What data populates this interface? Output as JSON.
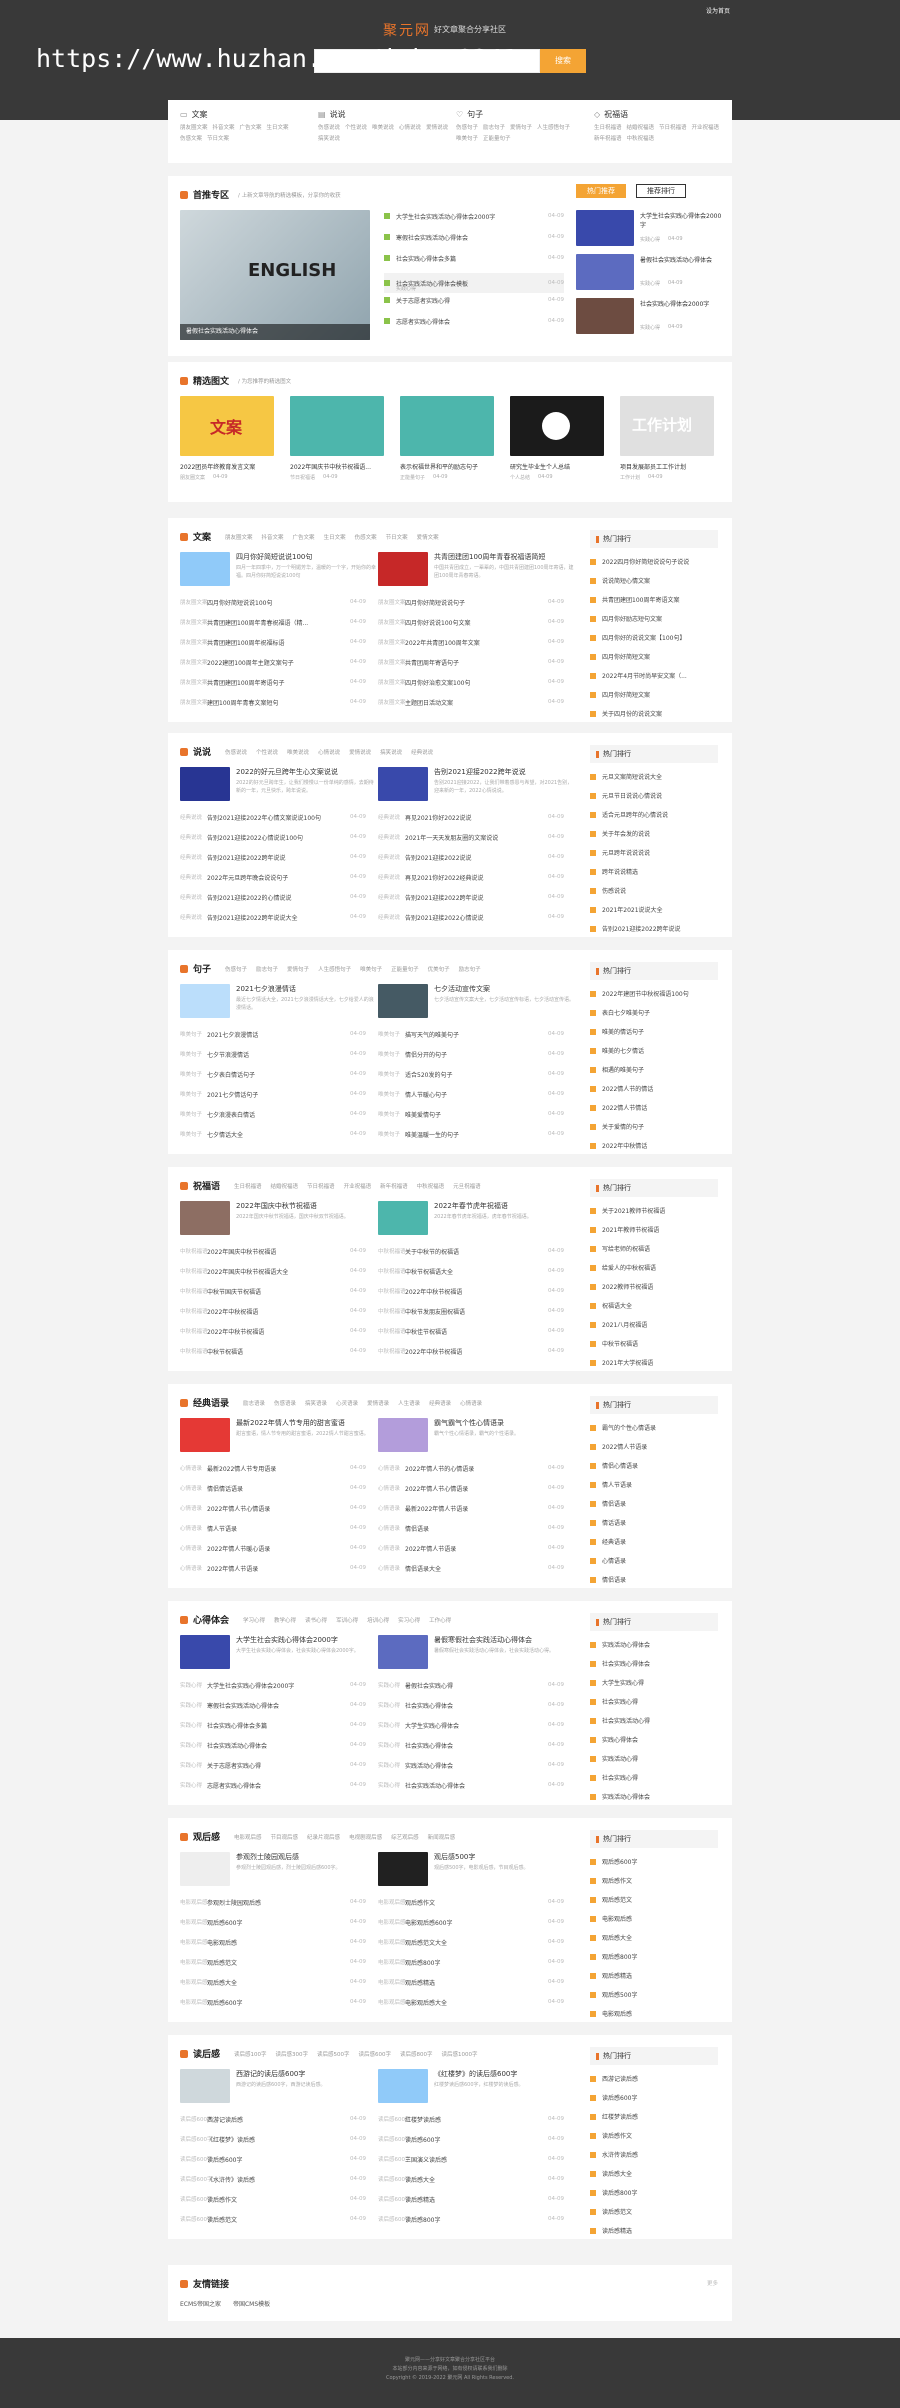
{
  "header": {
    "logo": "聚元网",
    "slogan": "好文章聚合分享社区",
    "watermark": "https://www.huzhan.com/ishop8341",
    "search_btn": "搜索",
    "top_right": "设为首页"
  },
  "cats": [
    {
      "name": "文案",
      "icon": "▭",
      "links": [
        "朋友圈文案",
        "抖音文案",
        "广告文案",
        "生日文案",
        "伤感文案",
        "节日文案"
      ]
    },
    {
      "name": "说说",
      "icon": "▤",
      "links": [
        "伤感说说",
        "个性说说",
        "唯美说说",
        "心情说说",
        "爱情说说",
        "搞笑说说"
      ]
    },
    {
      "name": "句子",
      "icon": "♡",
      "links": [
        "伤感句子",
        "励志句子",
        "爱情句子",
        "人生感悟句子",
        "唯美句子",
        "正能量句子"
      ]
    },
    {
      "name": "祝福语",
      "icon": "◇",
      "links": [
        "生日祝福语",
        "结婚祝福语",
        "节日祝福语",
        "开业祝福语",
        "新年祝福语",
        "中秋祝福语"
      ]
    }
  ],
  "featured": {
    "title": "首推专区",
    "sub": "/ 上新文章导航的精选模板，分享你的收获",
    "btn1": "热门推荐",
    "btn2": "推荐排行",
    "slide_title": "暑假社会实践活动心得体会",
    "image_word": "ENGLISH",
    "items": [
      {
        "t": "大学生社会实践活动心得体会2000字",
        "d": "04-09"
      },
      {
        "t": "寒假社会实践活动心得体会",
        "d": "04-09"
      },
      {
        "t": "社会实践心得体会多篇",
        "d": "04-09"
      },
      {
        "t": "社会实践活动心得体会模板",
        "d": "04-09"
      },
      {
        "t": "关于志愿者实践心得",
        "d": "04-09"
      },
      {
        "t": "志愿者实践心得体会",
        "d": "04-09"
      }
    ],
    "hi_sub": "实践心得",
    "right": [
      {
        "t": "大学生社会实践心得体会2000字",
        "c": "实践心得",
        "d": "04-09"
      },
      {
        "t": "暑假社会实践活动心得体会",
        "c": "实践心得",
        "d": "04-09"
      },
      {
        "t": "社会实践心得体会2000字",
        "c": "实践心得",
        "d": "04-09"
      }
    ]
  },
  "gallery": {
    "title": "精选图文",
    "sub": "/ 为您推荐的精选图文",
    "word1": "文案",
    "word2": "工作计划",
    "items": [
      {
        "t": "2022团员年终教育发言文案",
        "c": "朋友圈文案",
        "d": "04-09"
      },
      {
        "t": "2022年国庆节中秋节祝福语...",
        "c": "节日祝福语",
        "d": "04-09"
      },
      {
        "t": "表示祝福世界和平的励志句子",
        "c": "正能量句子",
        "d": "04-09"
      },
      {
        "t": "研究生毕业生个人总结",
        "c": "个人总结",
        "d": "04-09"
      },
      {
        "t": "项目发展部员工工作计划",
        "c": "工作计划",
        "d": "04-09"
      }
    ]
  },
  "sections": [
    {
      "title": "文案",
      "tags": [
        "朋友圈文案",
        "抖音文案",
        "广告文案",
        "生日文案",
        "伤感文案",
        "节日文案",
        "爱情文案"
      ],
      "arts": [
        {
          "t": "四月你好简短说说100句",
          "d": "四月一年四季中，万一个明媚芳华，温暖的一个字，开始你的幸福。四月你好简短说说100句"
        },
        {
          "t": "共青团建团100周年青春祝福语简短",
          "d": "中国共青团成立，一辈辈的，中国共青团建团100周年寄语，建团100周年青春寄语。"
        }
      ],
      "L": [
        {
          "c": "朋友圈文案",
          "t": "四月你好简短说说100句",
          "d": "04-09"
        },
        {
          "c": "朋友圈文案",
          "t": "共青团建团100周年青春祝福语（精...",
          "d": "04-09"
        },
        {
          "c": "朋友圈文案",
          "t": "共青团建团100周年祝福标语",
          "d": "04-09"
        },
        {
          "c": "朋友圈文案",
          "t": "2022建团100周年主题文案句子",
          "d": "04-09"
        },
        {
          "c": "朋友圈文案",
          "t": "共青团建团100周年寄语句子",
          "d": "04-09"
        },
        {
          "c": "朋友圈文案",
          "t": "建团100周年青春文案短句",
          "d": "04-09"
        }
      ],
      "R": [
        {
          "c": "朋友圈文案",
          "t": "四月你好简短说说句子",
          "d": "04-09"
        },
        {
          "c": "朋友圈文案",
          "t": "四月你好说说100句文案",
          "d": "04-09"
        },
        {
          "c": "朋友圈文案",
          "t": "2022年共青团100周年文案",
          "d": "04-09"
        },
        {
          "c": "朋友圈文案",
          "t": "共青团周年寄语句子",
          "d": "04-09"
        },
        {
          "c": "朋友圈文案",
          "t": "四月你好治愈文案100句",
          "d": "04-09"
        },
        {
          "c": "朋友圈文案",
          "t": "主题团日活动文案",
          "d": "04-09"
        }
      ],
      "side": [
        "2022四月你好简短说说句子说说",
        "说说简短心情文案",
        "共青团建团100周年寄语文案",
        "四月你好励志短句文案",
        "四月你好的说说文案【100句】",
        "四月你好简短文案",
        "2022年4月节时尚早安文案（...",
        "四月你好简短文案",
        "关于四月份的说说文案"
      ]
    },
    {
      "title": "说说",
      "tags": [
        "伤感说说",
        "个性说说",
        "唯美说说",
        "心情说说",
        "爱情说说",
        "搞笑说说",
        "经典说说"
      ],
      "arts": [
        {
          "t": "2022的好元旦跨年生心文案说说",
          "d": "2022的好元旦跨年生，让我们慢慢以一份单纯的感情，去期待新的一年，元旦快乐，跨年说说。"
        },
        {
          "t": "告别2021迎接2022跨年说说",
          "d": "告别2021迎接2022，让我们带着感恩与希望，对2021告别，迎来新的一年，2022心情说说。"
        }
      ],
      "L": [
        {
          "c": "经典说说",
          "t": "告别2021迎接2022年心情文案说说100句",
          "d": "04-09"
        },
        {
          "c": "经典说说",
          "t": "告别2021迎接2022心情说说100句",
          "d": "04-09"
        },
        {
          "c": "经典说说",
          "t": "告别2021迎接2022跨年说说",
          "d": "04-09"
        },
        {
          "c": "经典说说",
          "t": "2022年元旦跨年晚会说说句子",
          "d": "04-09"
        },
        {
          "c": "经典说说",
          "t": "告别2021迎接2022的心情说说",
          "d": "04-09"
        },
        {
          "c": "经典说说",
          "t": "告别2021迎接2022跨年说说大全",
          "d": "04-09"
        }
      ],
      "R": [
        {
          "c": "经典说说",
          "t": "再见2021你好2022说说",
          "d": "04-09"
        },
        {
          "c": "经典说说",
          "t": "2021年一天天发朋友圈的文案说说",
          "d": "04-09"
        },
        {
          "c": "经典说说",
          "t": "告别2021迎接2022说说",
          "d": "04-09"
        },
        {
          "c": "经典说说",
          "t": "再见2021你好2022经典说说",
          "d": "04-09"
        },
        {
          "c": "经典说说",
          "t": "告别2021迎接2022跨年说说",
          "d": "04-09"
        },
        {
          "c": "经典说说",
          "t": "告别2021迎接2022心情说说",
          "d": "04-09"
        }
      ],
      "side": [
        "元旦文案简短说说大全",
        "元旦节日说说心情说说",
        "适合元旦跨年的心情说说",
        "关于年会发的说说",
        "元旦跨年说说说说",
        "跨年说说精选",
        "伤感说说",
        "2021年2021说说大全",
        "告别2021迎接2022跨年说说"
      ]
    },
    {
      "title": "句子",
      "tags": [
        "伤感句子",
        "励志句子",
        "爱情句子",
        "人生感悟句子",
        "唯美句子",
        "正能量句子",
        "优美句子",
        "励志句子"
      ],
      "arts": [
        {
          "t": "2021七夕浪漫情话",
          "d": "最近七夕情话大全，2021七夕浪漫情话大全，七夕给爱人的浪漫情话。"
        },
        {
          "t": "七夕活动宣传文案",
          "d": "七夕活动宣传文案大全，七夕活动宣传标语，七夕活动宣传语。"
        }
      ],
      "L": [
        {
          "c": "唯美句子",
          "t": "2021七夕浪漫情话",
          "d": "04-09"
        },
        {
          "c": "唯美句子",
          "t": "七夕节浪漫情话",
          "d": "04-09"
        },
        {
          "c": "唯美句子",
          "t": "七夕表白情话句子",
          "d": "04-09"
        },
        {
          "c": "唯美句子",
          "t": "2021七夕情话句子",
          "d": "04-09"
        },
        {
          "c": "唯美句子",
          "t": "七夕浪漫表白情话",
          "d": "04-09"
        },
        {
          "c": "唯美句子",
          "t": "七夕情话大全",
          "d": "04-09"
        }
      ],
      "R": [
        {
          "c": "唯美句子",
          "t": "描写天气的唯美句子",
          "d": "04-09"
        },
        {
          "c": "唯美句子",
          "t": "情侣分开的句子",
          "d": "04-09"
        },
        {
          "c": "唯美句子",
          "t": "适合520发的句子",
          "d": "04-09"
        },
        {
          "c": "唯美句子",
          "t": "情人节暖心句子",
          "d": "04-09"
        },
        {
          "c": "唯美句子",
          "t": "唯美爱情句子",
          "d": "04-09"
        },
        {
          "c": "唯美句子",
          "t": "唯美温暖一生的句子",
          "d": "04-09"
        }
      ],
      "side": [
        "2022年建团节中秋祝福语100句",
        "表白七夕唯美句子",
        "唯美的情话句子",
        "唯美的七夕情话",
        "相遇的唯美句子",
        "2022情人节的情话",
        "2022情人节情话",
        "关于爱情的句子",
        "2022年中秋情话"
      ]
    },
    {
      "title": "祝福语",
      "tags": [
        "生日祝福语",
        "结婚祝福语",
        "节日祝福语",
        "开业祝福语",
        "新年祝福语",
        "中秋祝福语",
        "元旦祝福语"
      ],
      "arts": [
        {
          "t": "2022年国庆中秋节祝福语",
          "d": "2022年国庆中秋节祝福语，国庆中秋双节祝福语。"
        },
        {
          "t": "2022年春节虎年祝福语",
          "d": "2022年春节虎年祝福语，虎年春节祝福语。"
        }
      ],
      "L": [
        {
          "c": "中秋祝福语",
          "t": "2022年国庆中秋节祝福语",
          "d": "04-09"
        },
        {
          "c": "中秋祝福语",
          "t": "2022年国庆中秋节祝福语大全",
          "d": "04-09"
        },
        {
          "c": "中秋祝福语",
          "t": "中秋节国庆节祝福语",
          "d": "04-09"
        },
        {
          "c": "中秋祝福语",
          "t": "2022年中秋祝福语",
          "d": "04-09"
        },
        {
          "c": "中秋祝福语",
          "t": "2022年中秋节祝福语",
          "d": "04-09"
        },
        {
          "c": "中秋祝福语",
          "t": "中秋节祝福语",
          "d": "04-09"
        }
      ],
      "R": [
        {
          "c": "中秋祝福语",
          "t": "关于中秋节的祝福语",
          "d": "04-09"
        },
        {
          "c": "中秋祝福语",
          "t": "中秋节祝福语大全",
          "d": "04-09"
        },
        {
          "c": "中秋祝福语",
          "t": "2022年中秋节祝福语",
          "d": "04-09"
        },
        {
          "c": "中秋祝福语",
          "t": "中秋节发朋友圈祝福语",
          "d": "04-09"
        },
        {
          "c": "中秋祝福语",
          "t": "中秋佳节祝福语",
          "d": "04-09"
        },
        {
          "c": "中秋祝福语",
          "t": "2022年中秋节祝福语",
          "d": "04-09"
        }
      ],
      "side": [
        "关于2021教师节祝福语",
        "2021年教师节祝福语",
        "写给老师的祝福语",
        "给爱人的中秋祝福语",
        "2022教师节祝福语",
        "祝福语大全",
        "2021八月祝福语",
        "中秋节祝福语",
        "2021年大学祝福语"
      ]
    },
    {
      "title": "经典语录",
      "tags": [
        "励志语录",
        "伤感语录",
        "搞笑语录",
        "心灵语录",
        "爱情语录",
        "人生语录",
        "经典语录",
        "心情语录"
      ],
      "arts": [
        {
          "t": "最新2022年情人节专用的甜言蜜语",
          "d": "甜言蜜语，情人节专用的甜言蜜语，2022情人节甜言蜜语。"
        },
        {
          "t": "霸气霸气个性心情语录",
          "d": "霸气个性心情语录，霸气的个性语录。"
        }
      ],
      "L": [
        {
          "c": "心情语录",
          "t": "最新2022情人节专用语录",
          "d": "04-09"
        },
        {
          "c": "心情语录",
          "t": "情侣情话语录",
          "d": "04-09"
        },
        {
          "c": "心情语录",
          "t": "2022年情人节心情语录",
          "d": "04-09"
        },
        {
          "c": "心情语录",
          "t": "情人节语录",
          "d": "04-09"
        },
        {
          "c": "心情语录",
          "t": "2022年情人节暖心语录",
          "d": "04-09"
        },
        {
          "c": "心情语录",
          "t": "2022年情人节语录",
          "d": "04-09"
        }
      ],
      "R": [
        {
          "c": "心情语录",
          "t": "2022年情人节的心情语录",
          "d": "04-09"
        },
        {
          "c": "心情语录",
          "t": "2022年情人节心情语录",
          "d": "04-09"
        },
        {
          "c": "心情语录",
          "t": "最新2022年情人节语录",
          "d": "04-09"
        },
        {
          "c": "心情语录",
          "t": "情侣语录",
          "d": "04-09"
        },
        {
          "c": "心情语录",
          "t": "2022年情人节语录",
          "d": "04-09"
        },
        {
          "c": "心情语录",
          "t": "情侣语录大全",
          "d": "04-09"
        }
      ],
      "side": [
        "霸气的个性心情语录",
        "2022情人节语录",
        "情侣心情语录",
        "情人节语录",
        "情侣语录",
        "情话语录",
        "经典语录",
        "心情语录",
        "情侣语录"
      ]
    },
    {
      "title": "心得体会",
      "tags": [
        "学习心得",
        "教学心得",
        "读书心得",
        "军训心得",
        "培训心得",
        "实习心得",
        "工作心得"
      ],
      "arts": [
        {
          "t": "大学生社会实践心得体会2000字",
          "d": "大学生社会实践心得体会，社会实践心得体会2000字。"
        },
        {
          "t": "暑假寒假社会实践活动心得体会",
          "d": "暑假寒假社会实践活动心得体会，社会实践活动心得。"
        }
      ],
      "L": [
        {
          "c": "实践心得",
          "t": "大学生社会实践心得体会2000字",
          "d": "04-09"
        },
        {
          "c": "实践心得",
          "t": "寒假社会实践活动心得体会",
          "d": "04-09"
        },
        {
          "c": "实践心得",
          "t": "社会实践心得体会多篇",
          "d": "04-09"
        },
        {
          "c": "实践心得",
          "t": "社会实践活动心得体会",
          "d": "04-09"
        },
        {
          "c": "实践心得",
          "t": "关于志愿者实践心得",
          "d": "04-09"
        },
        {
          "c": "实践心得",
          "t": "志愿者实践心得体会",
          "d": "04-09"
        }
      ],
      "R": [
        {
          "c": "实践心得",
          "t": "暑假社会实践心得",
          "d": "04-09"
        },
        {
          "c": "实践心得",
          "t": "社会实践心得体会",
          "d": "04-09"
        },
        {
          "c": "实践心得",
          "t": "大学生实践心得体会",
          "d": "04-09"
        },
        {
          "c": "实践心得",
          "t": "社会实践心得体会",
          "d": "04-09"
        },
        {
          "c": "实践心得",
          "t": "实践活动心得体会",
          "d": "04-09"
        },
        {
          "c": "实践心得",
          "t": "社会实践活动心得体会",
          "d": "04-09"
        }
      ],
      "side": [
        "实践活动心得体会",
        "社会实践心得体会",
        "大学生实践心得",
        "社会实践心得",
        "社会实践活动心得",
        "实践心得体会",
        "实践活动心得",
        "社会实践心得",
        "实践活动心得体会"
      ]
    },
    {
      "title": "观后感",
      "tags": [
        "电影观后感",
        "节目观后感",
        "纪录片观后感",
        "电视剧观后感",
        "综艺观后感",
        "新闻观后感"
      ],
      "arts": [
        {
          "t": "参观烈士陵园观后感",
          "d": "参观烈士陵园观后感，烈士陵园观后感600字。"
        },
        {
          "t": "观后感500字",
          "d": "观后感500字，电影观后感，节目观后感。"
        }
      ],
      "L": [
        {
          "c": "电影观后感",
          "t": "参观烈士陵园观后感",
          "d": "04-09"
        },
        {
          "c": "电影观后感",
          "t": "观后感600字",
          "d": "04-09"
        },
        {
          "c": "电影观后感",
          "t": "电影观后感",
          "d": "04-09"
        },
        {
          "c": "电影观后感",
          "t": "观后感范文",
          "d": "04-09"
        },
        {
          "c": "电影观后感",
          "t": "观后感大全",
          "d": "04-09"
        },
        {
          "c": "电影观后感",
          "t": "观后感600字",
          "d": "04-09"
        }
      ],
      "R": [
        {
          "c": "电影观后感",
          "t": "观后感作文",
          "d": "04-09"
        },
        {
          "c": "电影观后感",
          "t": "电影观后感600字",
          "d": "04-09"
        },
        {
          "c": "电影观后感",
          "t": "观后感范文大全",
          "d": "04-09"
        },
        {
          "c": "电影观后感",
          "t": "观后感800字",
          "d": "04-09"
        },
        {
          "c": "电影观后感",
          "t": "观后感精选",
          "d": "04-09"
        },
        {
          "c": "电影观后感",
          "t": "电影观后感大全",
          "d": "04-09"
        }
      ],
      "side": [
        "观后感600字",
        "观后感作文",
        "观后感范文",
        "电影观后感",
        "观后感大全",
        "观后感800字",
        "观后感精选",
        "观后感500字",
        "电影观后感"
      ]
    },
    {
      "title": "读后感",
      "tags": [
        "读后感100字",
        "读后感300字",
        "读后感500字",
        "读后感600字",
        "读后感800字",
        "读后感1000字"
      ],
      "arts": [
        {
          "t": "西游记的读后感600字",
          "d": "西游记的读后感600字，西游记读后感。"
        },
        {
          "t": "《红楼梦》的读后感600字",
          "d": "红楼梦读后感600字，红楼梦的读后感。"
        }
      ],
      "L": [
        {
          "c": "读后感600字",
          "t": "西游记读后感",
          "d": "04-09"
        },
        {
          "c": "读后感600字",
          "t": "《红楼梦》读后感",
          "d": "04-09"
        },
        {
          "c": "读后感600字",
          "t": "读后感600字",
          "d": "04-09"
        },
        {
          "c": "读后感600字",
          "t": "《水浒传》读后感",
          "d": "04-09"
        },
        {
          "c": "读后感600字",
          "t": "读后感作文",
          "d": "04-09"
        },
        {
          "c": "读后感600字",
          "t": "读后感范文",
          "d": "04-09"
        }
      ],
      "R": [
        {
          "c": "读后感600字",
          "t": "红楼梦读后感",
          "d": "04-09"
        },
        {
          "c": "读后感600字",
          "t": "读后感600字",
          "d": "04-09"
        },
        {
          "c": "读后感600字",
          "t": "三国演义读后感",
          "d": "04-09"
        },
        {
          "c": "读后感600字",
          "t": "读后感大全",
          "d": "04-09"
        },
        {
          "c": "读后感600字",
          "t": "读后感精选",
          "d": "04-09"
        },
        {
          "c": "读后感600字",
          "t": "读后感800字",
          "d": "04-09"
        }
      ],
      "side": [
        "西游记读后感",
        "读后感600字",
        "红楼梦读后感",
        "读后感作文",
        "水浒传读后感",
        "读后感大全",
        "读后感800字",
        "读后感范文",
        "读后感精选"
      ]
    }
  ],
  "friends": {
    "title": "友情链接",
    "more": "更多",
    "links": [
      "ECMS帝国之家",
      "帝国CMS模板"
    ]
  },
  "footer": {
    "l1": "聚元网——分享好文章聚合分享社区平台",
    "l2": "本站部分内容来源于网络，如有侵权请联系我们删除",
    "l3": "Copyright © 2019-2022 聚元网 All Rights Reserved."
  },
  "colors": {
    "accent": "#e8742b",
    "header": "#393939",
    "search_btn": "#f4a434"
  }
}
